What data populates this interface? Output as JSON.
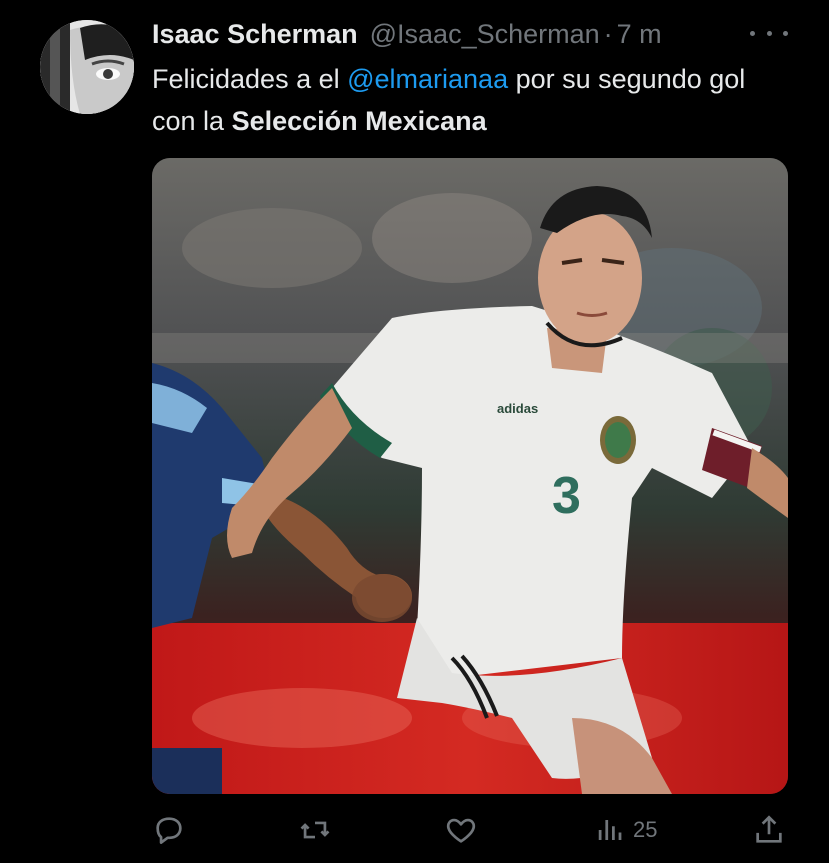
{
  "author": {
    "name": "Isaac Scherman",
    "handle": "@Isaac_Scherman",
    "separator": "·",
    "time": "7 m"
  },
  "tweet": {
    "part1": "Felicidades a el ",
    "mention": "@elmarianaa",
    "part2": " por su segundo gol con la ",
    "bold": "Selección Mexicana"
  },
  "media": {
    "description_icon": "soccer-photo",
    "jersey_number": "3",
    "brand": "adidas"
  },
  "actions": {
    "reply_icon": "reply-icon",
    "retweet_icon": "retweet-icon",
    "like_icon": "heart-icon",
    "views_icon": "views-icon",
    "views_count": "25",
    "share_icon": "share-icon"
  },
  "colors": {
    "background": "#000000",
    "text": "#e7e9ea",
    "muted": "#71767b",
    "link": "#1d9bf0"
  }
}
